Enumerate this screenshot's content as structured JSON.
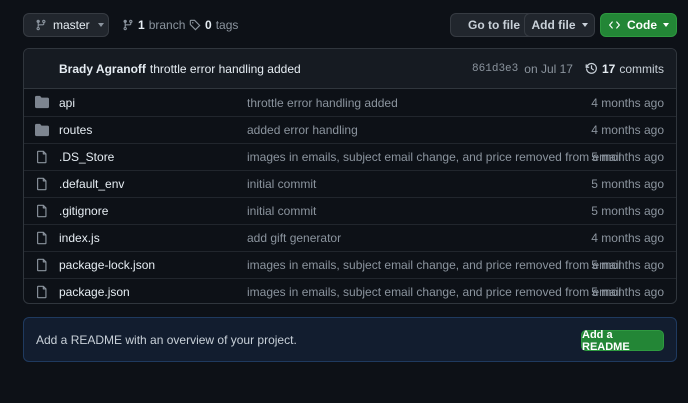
{
  "toolbar": {
    "branch_name": "master",
    "branches_count": "1",
    "branches_label": "branch",
    "tags_count": "0",
    "tags_label": "tags",
    "goto_file_label": "Go to file",
    "add_file_label": "Add file",
    "code_label": "Code"
  },
  "colors": {
    "background": "#0d1117",
    "accent_green": "#238636",
    "notification_blue": "#58a6ff",
    "folder_icon": "#7d8590"
  },
  "commit": {
    "author": "Brady Agranoff",
    "message": "throttle error handling added",
    "hash": "861d3e3",
    "date": "on Jul 17",
    "commits_count": "17",
    "commits_label": "commits"
  },
  "files": [
    {
      "name": "api",
      "type": "folder",
      "icon": "folder-icon",
      "message": "throttle error handling added",
      "age": "4 months ago"
    },
    {
      "name": "routes",
      "type": "folder",
      "icon": "folder-icon",
      "message": "added error handling",
      "age": "4 months ago"
    },
    {
      "name": ".DS_Store",
      "type": "file",
      "icon": "file-icon",
      "message": "images in emails, subject email change, and price removed from email",
      "age": "5 months ago"
    },
    {
      "name": ".default_env",
      "type": "file",
      "icon": "file-icon",
      "message": "initial commit",
      "age": "5 months ago"
    },
    {
      "name": ".gitignore",
      "type": "file",
      "icon": "file-icon",
      "message": "initial commit",
      "age": "5 months ago"
    },
    {
      "name": "index.js",
      "type": "file",
      "icon": "file-icon",
      "message": "add gift generator",
      "age": "4 months ago"
    },
    {
      "name": "package-lock.json",
      "type": "file",
      "icon": "file-icon",
      "message": "images in emails, subject email change, and price removed from email",
      "age": "5 months ago"
    },
    {
      "name": "package.json",
      "type": "file",
      "icon": "file-icon",
      "message": "images in emails, subject email change, and price removed from email",
      "age": "5 months ago"
    }
  ],
  "readme": {
    "text": "Add a README with an overview of your project.",
    "button_label": "Add a README"
  }
}
